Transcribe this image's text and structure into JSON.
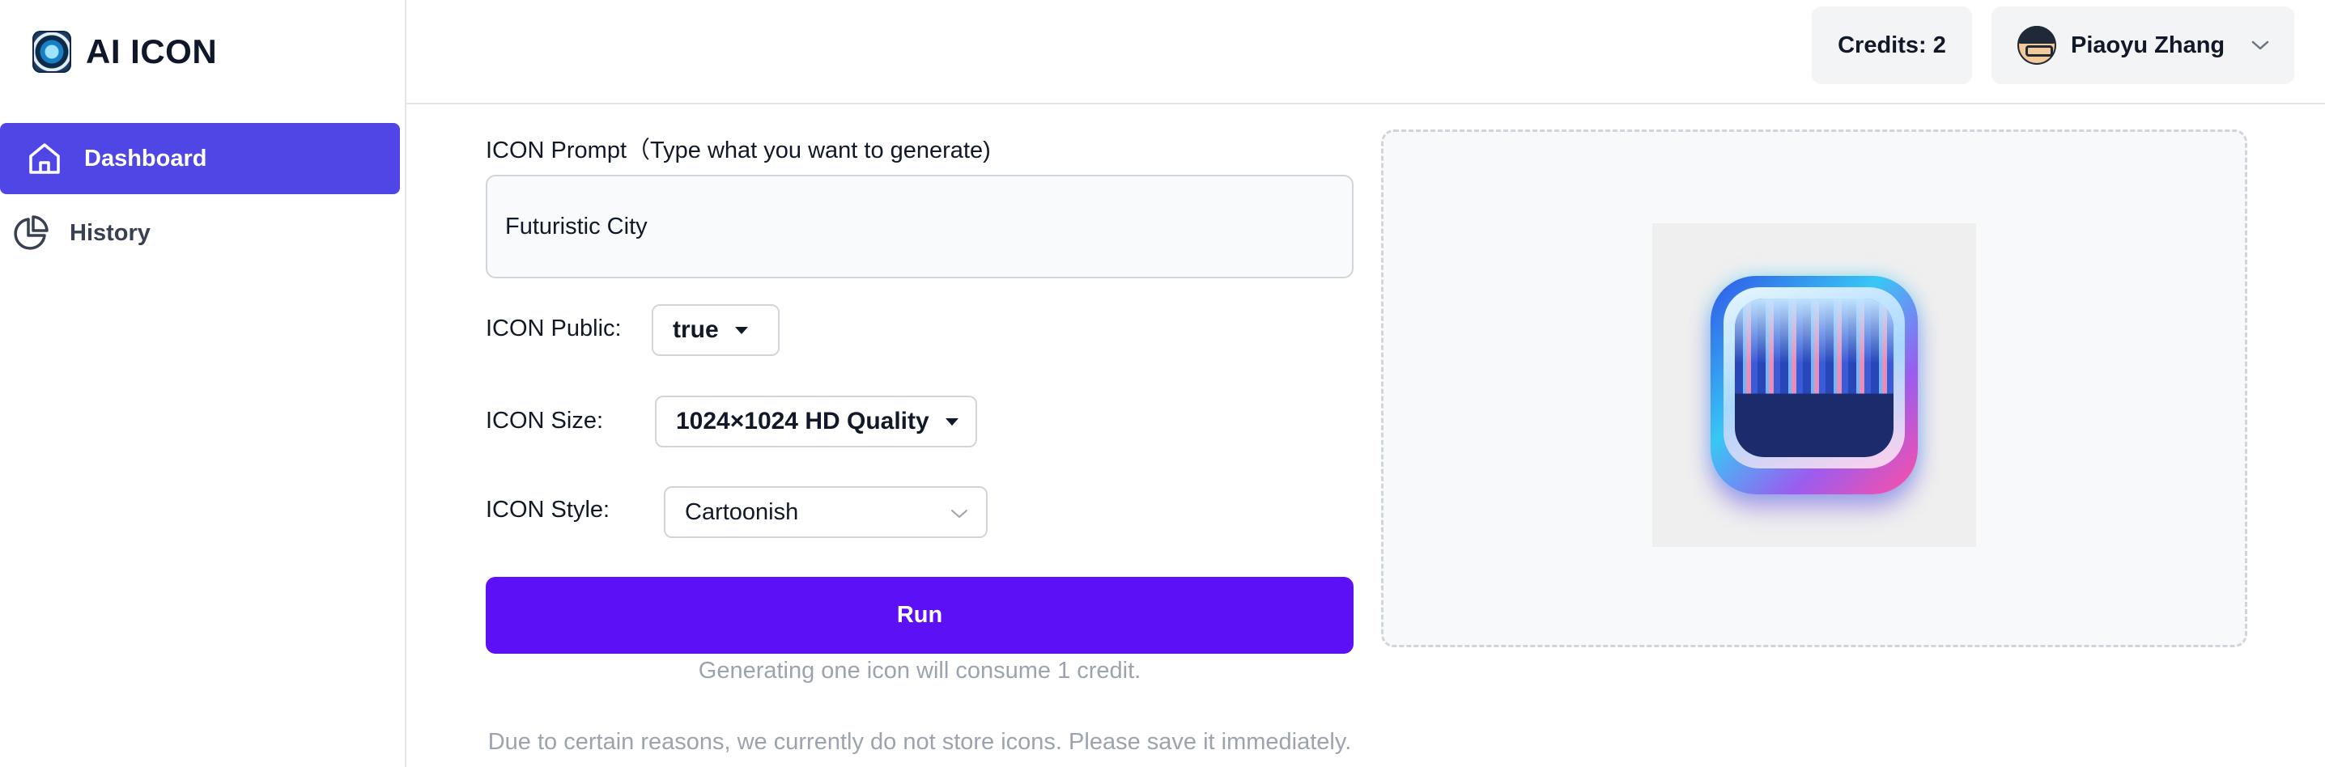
{
  "app": {
    "title": "AI ICON",
    "logo_icon": "camera-lens-icon"
  },
  "sidebar": {
    "items": [
      {
        "label": "Dashboard",
        "icon": "home-icon",
        "active": true
      },
      {
        "label": "History",
        "icon": "pie-chart-icon",
        "active": false
      }
    ]
  },
  "header": {
    "credits_label": "Credits: 2",
    "user_name": "Piaoyu Zhang",
    "user_menu_icon": "chevron-down-icon"
  },
  "form": {
    "prompt_label": "ICON Prompt（Type what you want to generate)",
    "prompt_value": "Futuristic City",
    "public_label": "ICON Public:",
    "public_value": "true",
    "size_label": "ICON Size:",
    "size_value": "1024×1024 HD Quality",
    "style_label": "ICON Style:",
    "style_value": "Cartoonish",
    "run_label": "Run",
    "credit_note": "Generating one icon will consume 1 credit.",
    "storage_note": "Due to certain reasons, we currently do not store icons. Please save it immediately."
  },
  "preview": {
    "image_icon": "futuristic-city-app-icon"
  },
  "colors": {
    "accent": "#4f46e5",
    "run_button": "#5b10f5",
    "muted_text": "#9ca3af",
    "border": "#d1d5db"
  }
}
